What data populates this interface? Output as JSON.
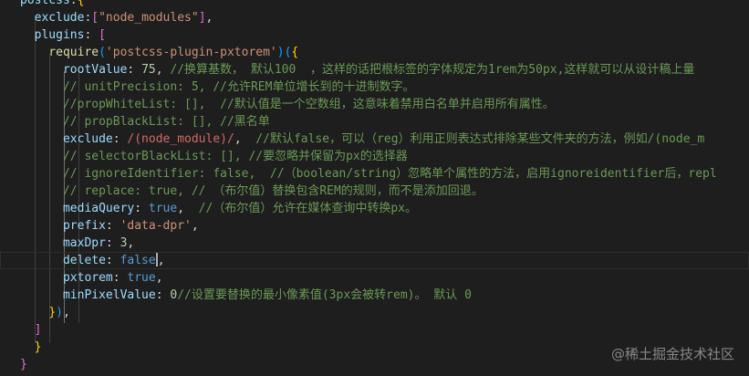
{
  "editor": {
    "lines": [
      [
        {
          "t": "postcss",
          "c": "k"
        },
        {
          "t": ":",
          "c": "p"
        },
        {
          "t": "{",
          "c": "br1"
        }
      ],
      [
        {
          "t": "  exclude",
          "c": "k"
        },
        {
          "t": ":",
          "c": "p"
        },
        {
          "t": "[",
          "c": "br2"
        },
        {
          "t": "\"node_modules\"",
          "c": "s"
        },
        {
          "t": "]",
          "c": "br2"
        },
        {
          "t": ",",
          "c": "p"
        }
      ],
      [
        {
          "t": "  plugins",
          "c": "k"
        },
        {
          "t": ": ",
          "c": "p"
        },
        {
          "t": "[",
          "c": "br2"
        }
      ],
      [
        {
          "t": "    require",
          "c": "f"
        },
        {
          "t": "(",
          "c": "br3"
        },
        {
          "t": "'postcss-plugin-pxtorem'",
          "c": "s"
        },
        {
          "t": ")",
          "c": "br3"
        },
        {
          "t": "(",
          "c": "br3"
        },
        {
          "t": "{",
          "c": "br1"
        }
      ],
      [
        {
          "t": "      rootValue",
          "c": "k"
        },
        {
          "t": ": ",
          "c": "p"
        },
        {
          "t": "75",
          "c": "n"
        },
        {
          "t": ", ",
          "c": "p"
        },
        {
          "t": "//换算基数， 默认100  ，这样的话把根标签的字体规定为1rem为50px,这样就可以从设计稿上量",
          "c": "c"
        }
      ],
      [
        {
          "t": "      // unitPrecision: 5, //允许REM单位增长到的十进制数字。",
          "c": "c"
        }
      ],
      [
        {
          "t": "      //propWhiteList: [],  //默认值是一个空数组，这意味着禁用白名单并启用所有属性。",
          "c": "c"
        }
      ],
      [
        {
          "t": "      // propBlackList: [], //黑名单",
          "c": "c"
        }
      ],
      [
        {
          "t": "      exclude",
          "c": "k"
        },
        {
          "t": ": ",
          "c": "p"
        },
        {
          "t": "/(node_module)/",
          "c": "r"
        },
        {
          "t": ",  ",
          "c": "p"
        },
        {
          "t": "//默认false，可以（reg）利用正则表达式排除某些文件夹的方法，例如/(node_m",
          "c": "c"
        }
      ],
      [
        {
          "t": "      // selectorBlackList: [], //要忽略并保留为px的选择器",
          "c": "c"
        }
      ],
      [
        {
          "t": "      // ignoreIdentifier: false,  //（boolean/string）忽略单个属性的方法，启用ignoreidentifier后，repl",
          "c": "c"
        }
      ],
      [
        {
          "t": "      // replace: true, // （布尔值）替换包含REM的规则，而不是添加回退。",
          "c": "c"
        }
      ],
      [
        {
          "t": "      mediaQuery",
          "c": "k"
        },
        {
          "t": ": ",
          "c": "p"
        },
        {
          "t": "true",
          "c": "b"
        },
        {
          "t": ",  ",
          "c": "p"
        },
        {
          "t": "//（布尔值）允许在媒体查询中转换px。",
          "c": "c"
        }
      ],
      [
        {
          "t": "      prefix",
          "c": "k"
        },
        {
          "t": ": ",
          "c": "p"
        },
        {
          "t": "'data-dpr'",
          "c": "s"
        },
        {
          "t": ",",
          "c": "p"
        }
      ],
      [
        {
          "t": "      maxDpr",
          "c": "k"
        },
        {
          "t": ": ",
          "c": "p"
        },
        {
          "t": "3",
          "c": "n"
        },
        {
          "t": ",",
          "c": "p"
        }
      ],
      [
        {
          "t": "      delete",
          "c": "k"
        },
        {
          "t": ": ",
          "c": "p"
        },
        {
          "t": "false",
          "c": "b"
        },
        {
          "t": "|",
          "c": "caret"
        },
        {
          "t": ",",
          "c": "p"
        }
      ],
      [
        {
          "t": "      pxtorem",
          "c": "k"
        },
        {
          "t": ": ",
          "c": "p"
        },
        {
          "t": "true",
          "c": "b"
        },
        {
          "t": ",",
          "c": "p"
        }
      ],
      [
        {
          "t": "      minPixelValue",
          "c": "k"
        },
        {
          "t": ": ",
          "c": "p"
        },
        {
          "t": "0",
          "c": "n"
        },
        {
          "t": "//设置要替换的最小像素值(3px会被转rem)。 默认 0",
          "c": "c"
        }
      ],
      [
        {
          "t": "    ",
          "c": "p"
        },
        {
          "t": "}",
          "c": "br1"
        },
        {
          "t": ")",
          "c": "br3"
        },
        {
          "t": ",",
          "c": "p"
        }
      ],
      [
        {
          "t": "  ",
          "c": "p"
        },
        {
          "t": "]",
          "c": "br2"
        }
      ],
      [
        {
          "t": "  ",
          "c": "p"
        },
        {
          "t": "}",
          "c": "br1"
        }
      ],
      [
        {
          "t": "}",
          "c": "br2"
        }
      ]
    ],
    "cursor_line": 15
  },
  "watermark": "@稀土掘金技术社区"
}
